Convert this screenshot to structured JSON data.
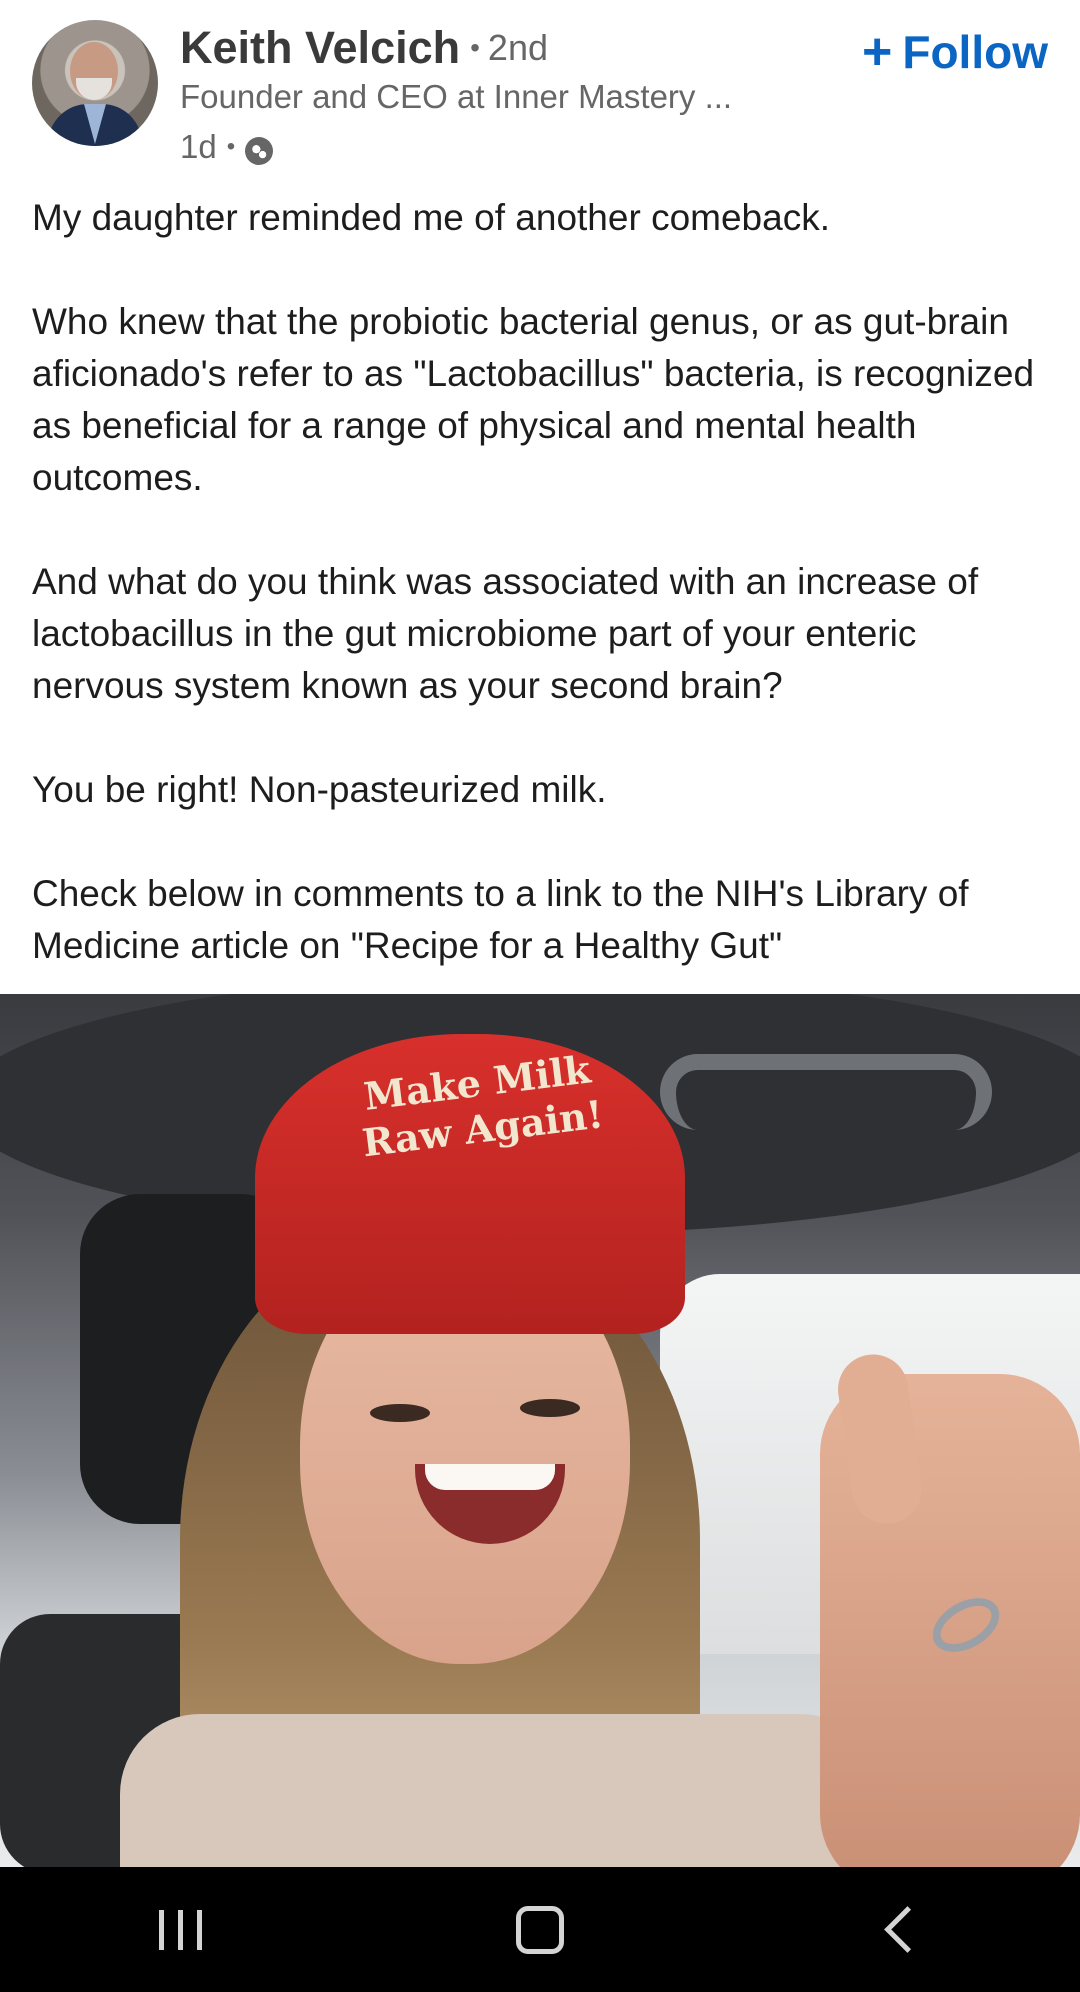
{
  "post": {
    "author": {
      "name": "Keith Velcich",
      "degree": "2nd",
      "headline": "Founder and CEO at Inner Mastery ...",
      "time": "1d",
      "visibility_icon": "globe-icon"
    },
    "follow": {
      "icon": "plus-icon",
      "label": "Follow"
    },
    "text": [
      "My daughter reminded me of another comeback.",
      "Who knew that the probiotic bacterial genus, or as gut-brain aficionado's refer to as \"Lactobacillus\" bacteria, is recognized as beneficial for a range of physical and mental health outcomes.",
      "And what do you think was associated with an increase of lactobacillus in the gut microbiome part of your enteric nervous system known as your second brain?",
      "You be right! Non-pasteurized milk.",
      "Check below in comments to a link to the NIH's Library of Medicine article on \"Recipe for a Healthy Gut\""
    ],
    "image": {
      "hat_text": "Make Milk Raw Again!"
    }
  },
  "colors": {
    "accent": "#0a66c2",
    "text": "#1d1d1d",
    "muted": "#666666",
    "navbar": "#000000"
  },
  "navbar": {
    "recents_icon": "recents-icon",
    "home_icon": "home-icon",
    "back_icon": "back-icon"
  }
}
